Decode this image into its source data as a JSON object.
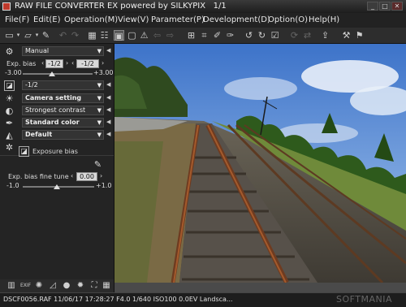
{
  "window": {
    "title": "RAW FILE CONVERTER EX powered by SILKYPIX",
    "page": "1/1",
    "minimize": "_",
    "maximize": "□",
    "close": "✕"
  },
  "menu": [
    "File(F)",
    "Edit(E)",
    "Operation(M)",
    "View(V)",
    "Parameter(P)",
    "Development(D)",
    "Option(O)",
    "Help(H)"
  ],
  "toolbar": {
    "icons": [
      "folder-open-icon",
      "folder-browse-icon",
      "eyedropper-icon",
      "undo-icon",
      "redo-icon",
      "grid-view-icon",
      "list-view-icon",
      "single-view-icon",
      "fit-view-icon",
      "warning-icon",
      "prev-image-icon",
      "next-image-icon",
      "crop-grid-icon",
      "white-balance-icon",
      "tone-picker-icon",
      "gray-picker-icon",
      "rotate-left-icon",
      "rotate-right-icon",
      "check-icon",
      "refresh-icon",
      "flip-icon",
      "export-icon",
      "tools-icon",
      "pin-icon"
    ]
  },
  "panel": {
    "exposure_mode": "Manual",
    "exp_bias_label": "Exp. bias",
    "exp_bias_value": "-1/2",
    "exp_bias_value2": "-1/2",
    "exp_min": "-3.00",
    "exp_max": "+3.00",
    "exp_slider_fraction": 0.42,
    "bias_preset": "-1/2",
    "camera_setting": "Camera setting",
    "contrast": "Strongest contrast",
    "color": "Standard color",
    "sharpness": "Default",
    "subpanel_title": "Exposure bias",
    "fine_tune_label": "Exp. bias fine tune",
    "fine_tune_value": "0.00",
    "fine_min": "-1.0",
    "fine_max": "+1.0",
    "fine_slider_fraction": 0.5
  },
  "bottom_icons": [
    "histogram-icon",
    "exif-icon",
    "color-wheel-icon",
    "tone-curve-icon",
    "sphere-icon",
    "brightness-icon",
    "fullscreen-icon",
    "grid-icon"
  ],
  "status": {
    "text": "DSCF0056.RAF 11/06/17 17:28:27 F4.0 1/640 ISO100 0.0EV Landsca...",
    "watermark": "SOFTMANIA"
  }
}
